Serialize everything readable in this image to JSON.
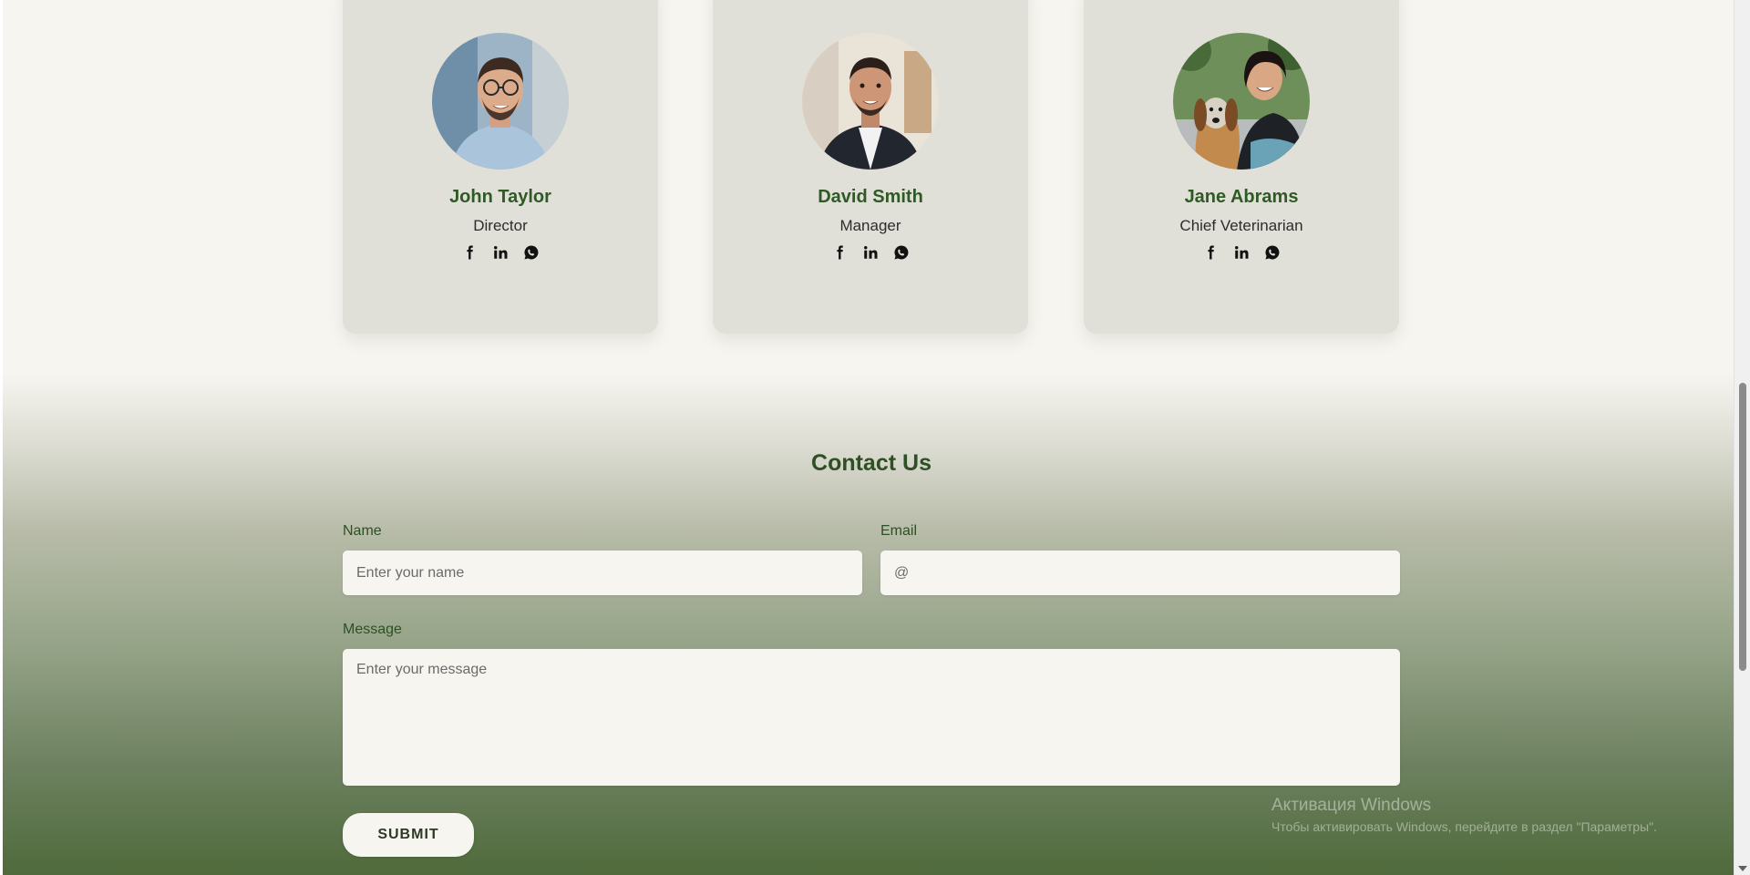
{
  "team": {
    "members": [
      {
        "name": "John Taylor",
        "role": "Director",
        "photo": "portrait-man-glasses"
      },
      {
        "name": "David Smith",
        "role": "Manager",
        "photo": "portrait-man-dark-jacket"
      },
      {
        "name": "Jane Abrams",
        "role": "Chief Veterinarian",
        "photo": "portrait-woman-with-dog"
      }
    ],
    "social_icons": [
      "facebook-icon",
      "linkedin-icon",
      "whatsapp-icon"
    ]
  },
  "contact": {
    "title": "Contact Us",
    "name_label": "Name",
    "name_placeholder": "Enter your name",
    "email_label": "Email",
    "email_placeholder": "@",
    "message_label": "Message",
    "message_placeholder": "Enter your message",
    "submit_label": "SUBMIT"
  },
  "watermark": {
    "title": "Активация Windows",
    "subtitle": "Чтобы активировать Windows, перейдите в раздел \"Параметры\"."
  },
  "colors": {
    "accent_green": "#2f5a26",
    "card_bg": "#e0e0d8",
    "page_bg": "#f6f5f0",
    "gradient_bottom": "#4f6a3b"
  }
}
